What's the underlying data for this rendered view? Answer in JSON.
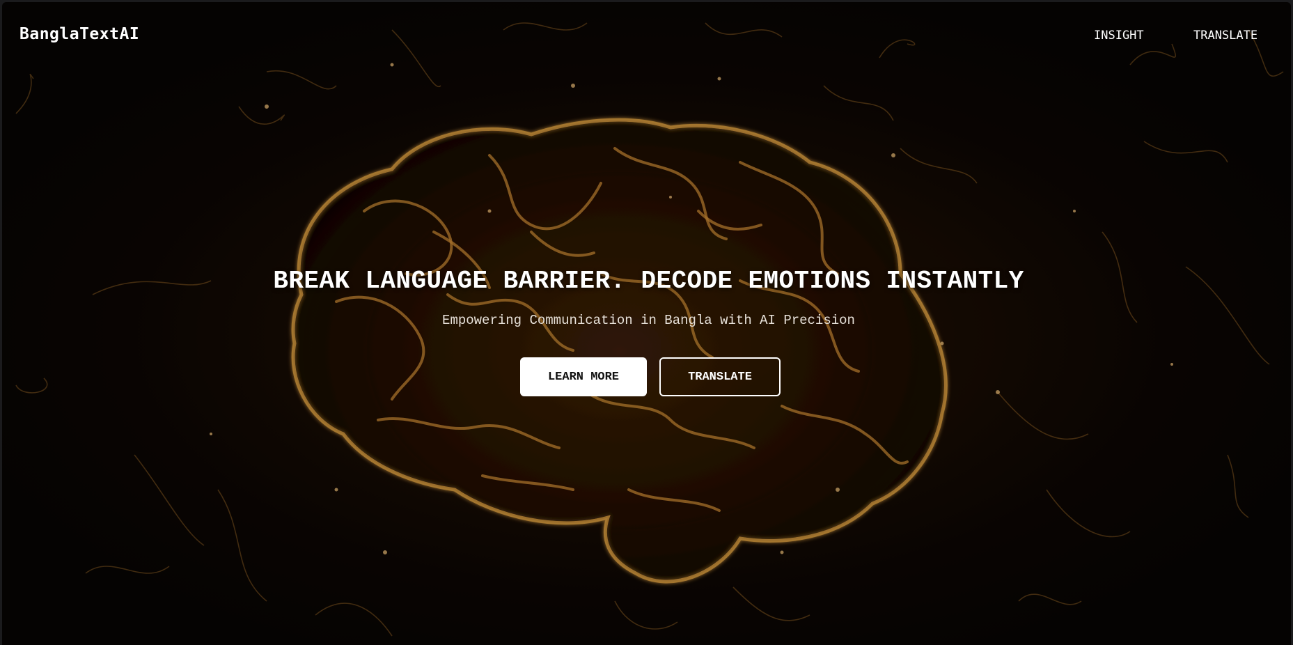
{
  "navbar": {
    "brand": "BanglaTextAI",
    "links": [
      {
        "label": "INSIGHT"
      },
      {
        "label": "TRANSLATE"
      }
    ]
  },
  "hero": {
    "title": "BREAK LANGUAGE BARRIER. DECODE EMOTIONS INSTANTLY",
    "subtitle": "Empowering Communication in Bangla with AI Precision",
    "buttons": {
      "learn_more": "LEARN MORE",
      "translate": "TRANSLATE"
    },
    "background_image": "glowing-brain-icon"
  },
  "colors": {
    "background": "#0b0603",
    "accent_glow": "#c8862a",
    "text": "#ffffff"
  }
}
